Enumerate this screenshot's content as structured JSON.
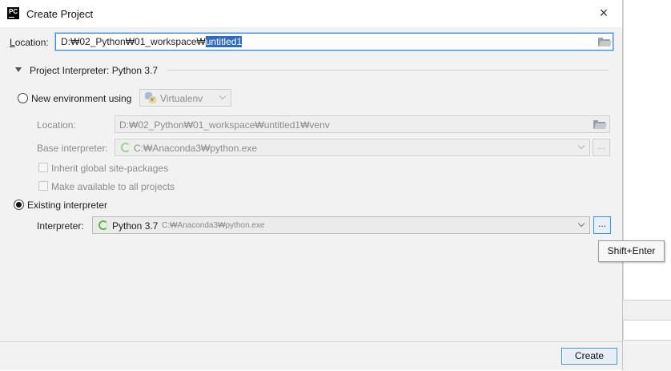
{
  "window": {
    "title": "Create Project",
    "app_icon_label": "PC"
  },
  "location": {
    "label": "Location:",
    "value_prefix": "D:₩02_Python₩01_workspace₩",
    "value_selected": "untitled1"
  },
  "section": {
    "title": "Project Interpreter: Python 3.7"
  },
  "new_env": {
    "label": "New environment using",
    "tool": "Virtualenv",
    "location_label": "Location:",
    "location_value": "D:₩02_Python₩01_workspace₩untitled1₩venv",
    "base_label": "Base interpreter:",
    "base_value": "C:₩Anaconda3₩python.exe",
    "inherit_label": "Inherit global site-packages",
    "make_available_label": "Make available to all projects"
  },
  "existing": {
    "label": "Existing interpreter",
    "interpreter_label": "Interpreter:",
    "interpreter_name": "Python 3.7",
    "interpreter_path": "C:₩Anaconda3₩python.exe",
    "browse_label": "..."
  },
  "tooltip": {
    "text": "Shift+Enter"
  },
  "footer": {
    "create_label": "Create"
  },
  "colors": {
    "accent": "#3d8ee0",
    "selection": "#2d6cc0",
    "spinner": "#58b947"
  },
  "icons": [
    "pycharm-app-icon",
    "close-icon",
    "folder-icon",
    "triangle-down-icon",
    "chevron-down-icon",
    "virtualenv-python-icon",
    "loading-spinner-icon"
  ]
}
